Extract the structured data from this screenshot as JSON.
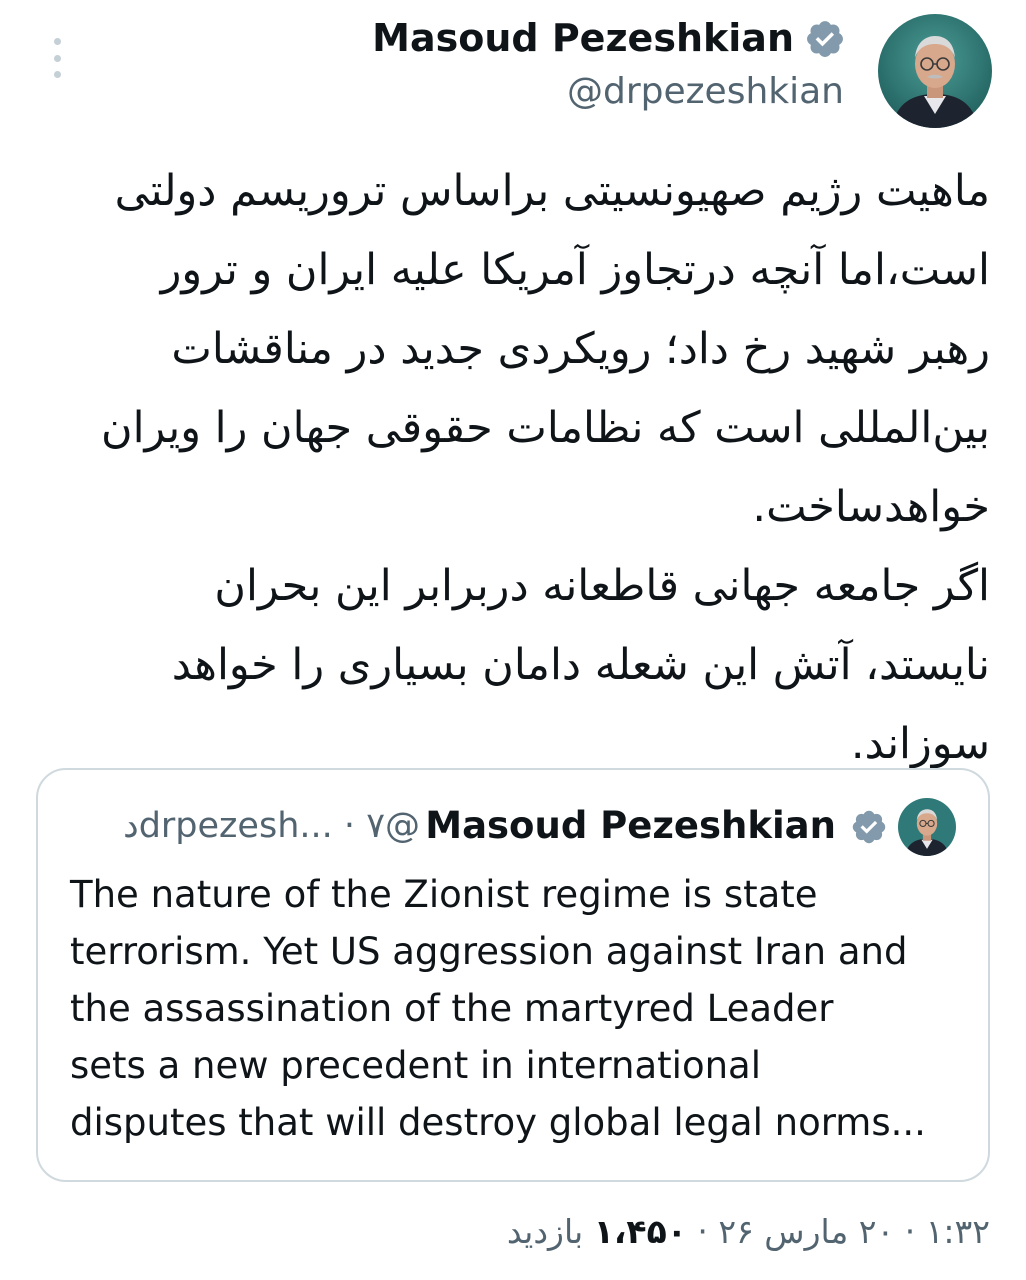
{
  "tweet": {
    "author_name": "Masoud Pezeshkian",
    "handle": "@drpezeshkian",
    "verified": true,
    "text": "ماهیت رژیم صهیونسیتی براساس تروریسم دولتی\nاست،اما آنچه درتجاوز آمریکا علیه ایران و ترور\nرهبر شهید رخ داد؛ رویکردی جدید در مناقشات\nبین‌المللی است که نظامات حقوقی جهان را ویران\nخواهدساخت.\nاگر جامعه جهانی قاطعانه دربرابر این بحران\nنایستد، آتش این شعله دامان بسیاری را خواهد\nسوزاند."
  },
  "quoted_tweet": {
    "author_name": "Masoud Pezeshkian",
    "handle": "@drpezesh...",
    "separator": "·",
    "time": "۷د",
    "verified": true,
    "text": "The nature of the Zionist regime is state\nterrorism. Yet US aggression against Iran and\nthe assassination of the martyred Leader\nsets a new precedent in international\ndisputes that will destroy global legal norms..."
  },
  "footer": {
    "time": "۱:۳۲",
    "separator": "·",
    "date": "۲۰ مارس ۲۶",
    "views_count": "۱،۴۵۰",
    "views_label": "بازدید"
  },
  "icons": {
    "more": "more-vertical-icon",
    "verified": "verified-badge-icon"
  },
  "colors": {
    "text": "#0f1419",
    "secondary_text": "#536471",
    "verified_badge": "#829aab",
    "border": "#cfd9de",
    "avatar_bg": "#2f7a78"
  }
}
